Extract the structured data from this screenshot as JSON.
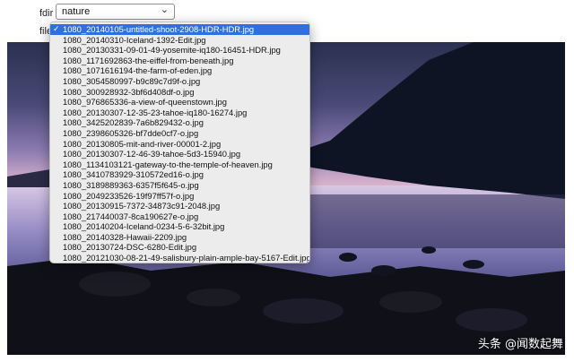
{
  "form": {
    "fdir_label": "fdir",
    "file_label": "file",
    "fdir_value": "nature"
  },
  "file_dropdown": {
    "selected_index": 0,
    "options": [
      "1080_20140105-untitled-shoot-2908-HDR-HDR.jpg",
      "1080_20140310-Iceland-1392-Edit.jpg",
      "1080_20130331-09-01-49-yosemite-iq180-16451-HDR.jpg",
      "1080_1171692863-the-eiffel-from-beneath.jpg",
      "1080_1071616194-the-farm-of-eden.jpg",
      "1080_3054580997-b9c89c7d9f-o.jpg",
      "1080_300928932-3bf6d408df-o.jpg",
      "1080_976865336-a-view-of-queenstown.jpg",
      "1080_20130307-12-35-23-tahoe-iq180-16274.jpg",
      "1080_3425202839-7a6b829432-o.jpg",
      "1080_2398605326-bf7dde0cf7-o.jpg",
      "1080_20130805-mit-and-river-00001-2.jpg",
      "1080_20130307-12-46-39-tahoe-5d3-15940.jpg",
      "1080_1134103121-gateway-to-the-temple-of-heaven.jpg",
      "1080_3410783929-310572ed16-o.jpg",
      "1080_3189889363-6357f5f645-o.jpg",
      "1080_2049233526-19f97ff57f-o.jpg",
      "1080_20130915-7372-34873c91-2048.jpg",
      "1080_217440037-8ca190627e-o.jpg",
      "1080_20140204-Iceland-0234-5-6-32bit.jpg",
      "1080_20140328-Hawaii-2209.jpg",
      "1080_20130724-DSC-6280-Edit.jpg",
      "1080_20121030-08-21-49-salisbury-plain-ample-bay-5167-Edit.jpg"
    ]
  },
  "watermark": "头条 @闻数起舞",
  "icons": {
    "select_chevron": "chevron-down-icon",
    "selected_check": "check-icon"
  }
}
